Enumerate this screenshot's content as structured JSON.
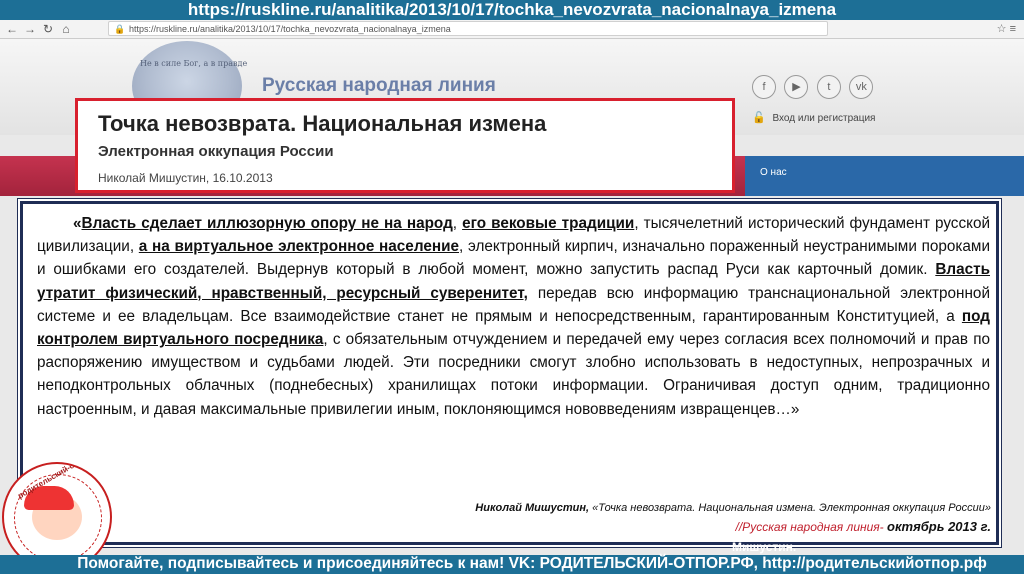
{
  "caption": {
    "url": "https://ruskline.ru/analitika/2013/10/17/tochka_nevozvrata_nacionalnaya_izmena"
  },
  "browser": {
    "address": "https://ruskline.ru/analitika/2013/10/17/tochka_nevozvrata_nacionalnaya_izmena"
  },
  "site": {
    "title": "Русская народная линия",
    "seal_text": "Не в силе Бог, а в правде",
    "social": [
      "f",
      "▶",
      "t",
      "vk"
    ],
    "login": "Вход или регистрация",
    "nav_item": "О нас"
  },
  "article": {
    "title": "Точка невозврата. Национальная измена",
    "subtitle": "Электронная оккупация России",
    "author_date": "Николай Мишустин, 16.10.2013"
  },
  "quote": {
    "p1a": "«",
    "p1b": "Власть сделает иллюзорную опору не на народ",
    "p1c": ", ",
    "p1d": "его вековые традиции",
    "p1e": ",  тысячелетний исторический фундамент русской цивилизации, ",
    "p1f": "а на виртуальное электронное население",
    "p1g": ", электронный кирпич, изначально пораженный неустранимыми пороками и ошибками его создателей. Выдернув который в любой момент, можно запустить распад Руси как карточный домик. ",
    "p1h": "Власть утратит физический, нравственный, ресурсный суверенитет,",
    "p1i": " передав всю информацию транснациональной электронной системе и ее владельцам. Все взаимодействие станет не прямым и непосредственным, гарантированным Конституцией, а ",
    "p1j": "под контролем виртуального посредника",
    "p1k": ", с обязательным отчуждением и  передачей ему через согласия всех полномочий и прав по распоряжению имуществом и судьбами людей. Эти посредники смогут злобно использовать в недоступных, непрозрачных и неподконтрольных облачных (поднебесных) хранилищах  потоки информации.  Ограничивая доступ одним, традиционно настроенным, и давая максимальные привилегии иным, поклоняющимся нововведениям извращенцев…»",
    "sig_name": "Николай Мишустин,",
    "sig_rest": " «Точка невозврата. Национальная измена. Электронная оккупация России»",
    "source": "//Русская народная линия- ",
    "source_date": "октябрь 2013 г."
  },
  "badge": {
    "text": "родительский-отпор.рф"
  },
  "footer": {
    "text": "Помогайте, подписывайтесь и присоединяйтесь к нам! VK: РОДИТЕЛЬСКИЙ-ОТПОР.РФ, http://родительскийотпор.рф",
    "behind_label": "Мишустин."
  },
  "colors": {
    "caption_bg": "#1d6f96",
    "frame_red": "#d8202e",
    "quote_border": "#1f2d55",
    "source_red": "#c01f2c"
  }
}
